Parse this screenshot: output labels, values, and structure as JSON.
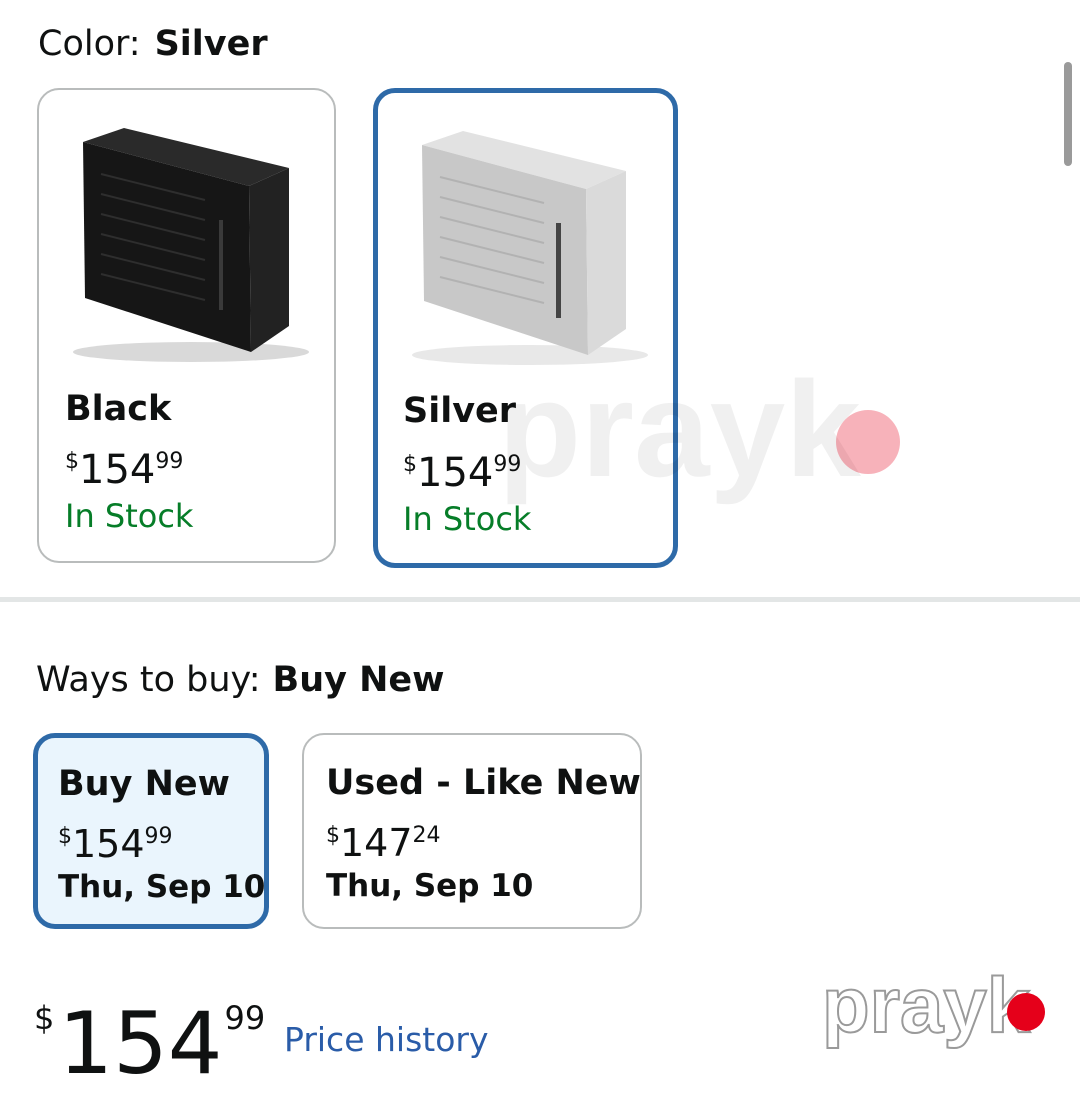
{
  "color_selector": {
    "label": "Color:",
    "selected_value": "Silver",
    "options": [
      {
        "name": "Black",
        "price": {
          "symbol": "$",
          "whole": "154",
          "fraction": "99"
        },
        "availability": "In Stock",
        "selected": false
      },
      {
        "name": "Silver",
        "price": {
          "symbol": "$",
          "whole": "154",
          "fraction": "99"
        },
        "availability": "In Stock",
        "selected": true
      }
    ]
  },
  "ways_to_buy": {
    "label": "Ways to buy:",
    "selected_value": "Buy New",
    "options": [
      {
        "title": "Buy New",
        "price": {
          "symbol": "$",
          "whole": "154",
          "fraction": "99"
        },
        "delivery": "Thu, Sep 10",
        "selected": true
      },
      {
        "title": "Used - Like New",
        "price": {
          "symbol": "$",
          "whole": "147",
          "fraction": "24"
        },
        "delivery": "Thu, Sep 10",
        "selected": false
      }
    ]
  },
  "main_price": {
    "symbol": "$",
    "whole": "154",
    "fraction": "99"
  },
  "price_history_link": "Price history",
  "watermark": {
    "text": "prayk"
  },
  "colors": {
    "selected_border": "#2e6aa8",
    "selected_fill": "#eaf5fd",
    "in_stock": "#067d28",
    "link": "#2a5ca8",
    "watermark_dot": "#e5001a"
  },
  "icons": [
    "black-case-image",
    "silver-case-image",
    "watermark-logo"
  ]
}
